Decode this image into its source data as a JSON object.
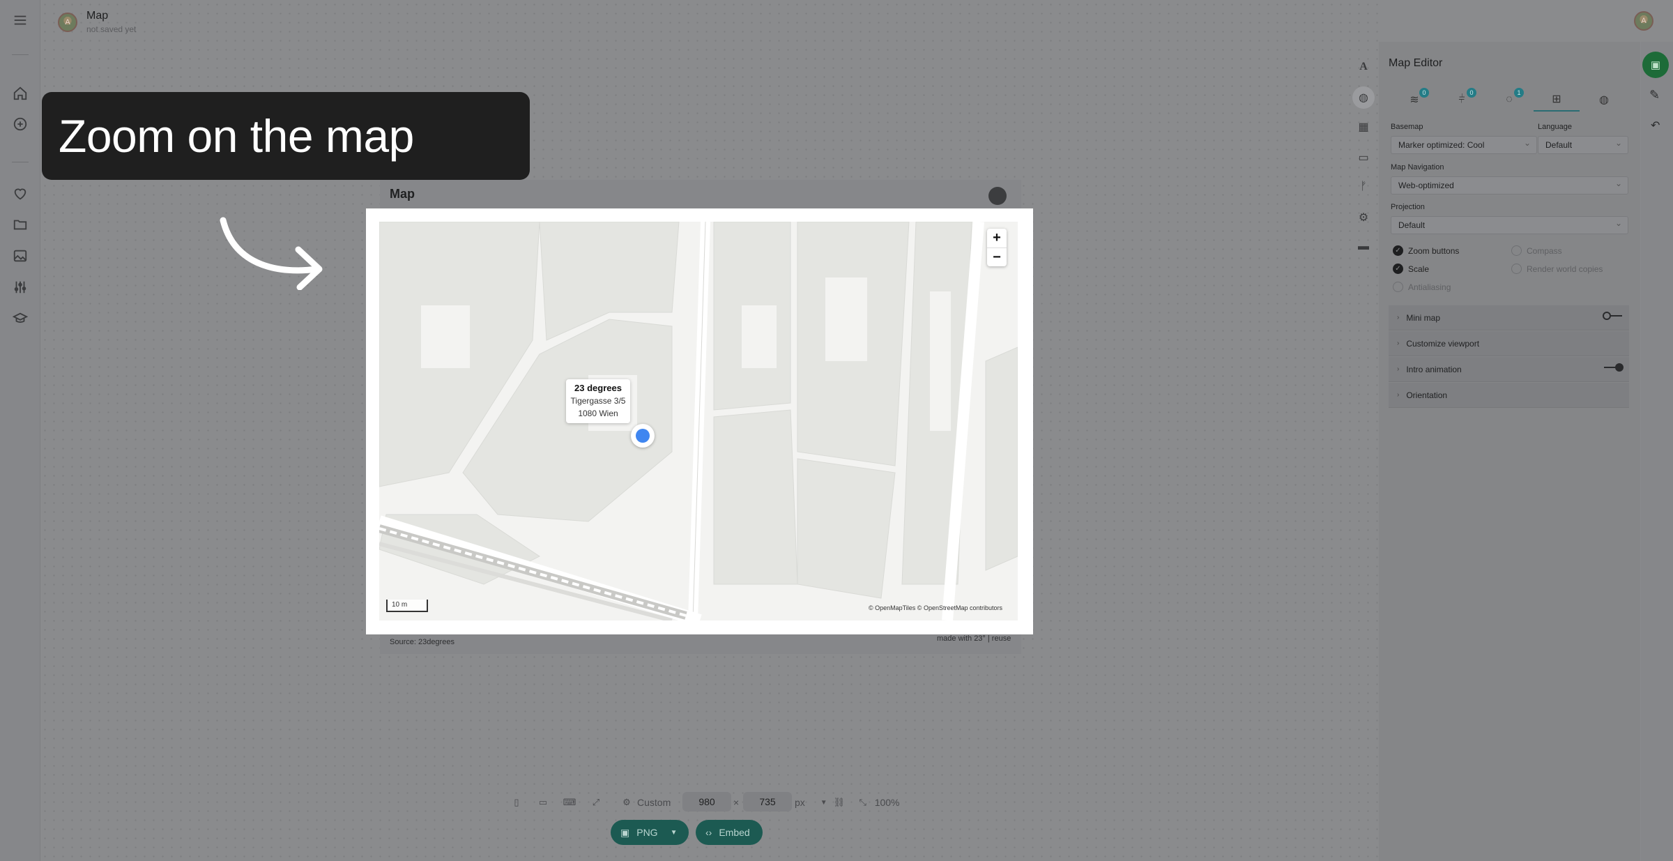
{
  "header": {
    "title": "Map",
    "subtitle": "not saved yet",
    "avatar_letter": "A"
  },
  "overlay": {
    "callout_text": "Zoom on the map"
  },
  "map_card": {
    "title": "Map",
    "source": "Source: 23degrees",
    "made_with": "made with 23° | reuse",
    "popup": {
      "title": "23 degrees",
      "line1": "Tigergasse 3/5",
      "line2": "1080 Wien"
    },
    "zoom_in": "+",
    "zoom_out": "−",
    "scale_label": "10 m",
    "attribution": "© OpenMapTiles © OpenStreetMap contributors",
    "marker_color": "#3f86f0"
  },
  "bottom_toolbar": {
    "preset": "Custom",
    "width": "980",
    "times": "×",
    "height": "735",
    "unit": "px",
    "zoom": "100%",
    "export_label": "PNG",
    "embed_label": "Embed"
  },
  "panel": {
    "title": "Map Editor",
    "tab_badges": [
      "0",
      "0",
      "1"
    ],
    "basemap_label": "Basemap",
    "basemap_value": "Marker optimized: Cool",
    "language_label": "Language",
    "language_value": "Default",
    "navigation_label": "Map Navigation",
    "navigation_value": "Web-optimized",
    "projection_label": "Projection",
    "projection_value": "Default",
    "options": {
      "zoom_buttons": "Zoom buttons",
      "compass": "Compass",
      "scale": "Scale",
      "render_world_copies": "Render world copies",
      "antialiasing": "Antialiasing"
    },
    "sections": {
      "mini_map": "Mini map",
      "customize_viewport": "Customize viewport",
      "intro_animation": "Intro animation",
      "orientation": "Orientation"
    }
  },
  "colors": {
    "accent": "#1c5a52",
    "save": "#1d6b38",
    "badge": "#247c86"
  }
}
